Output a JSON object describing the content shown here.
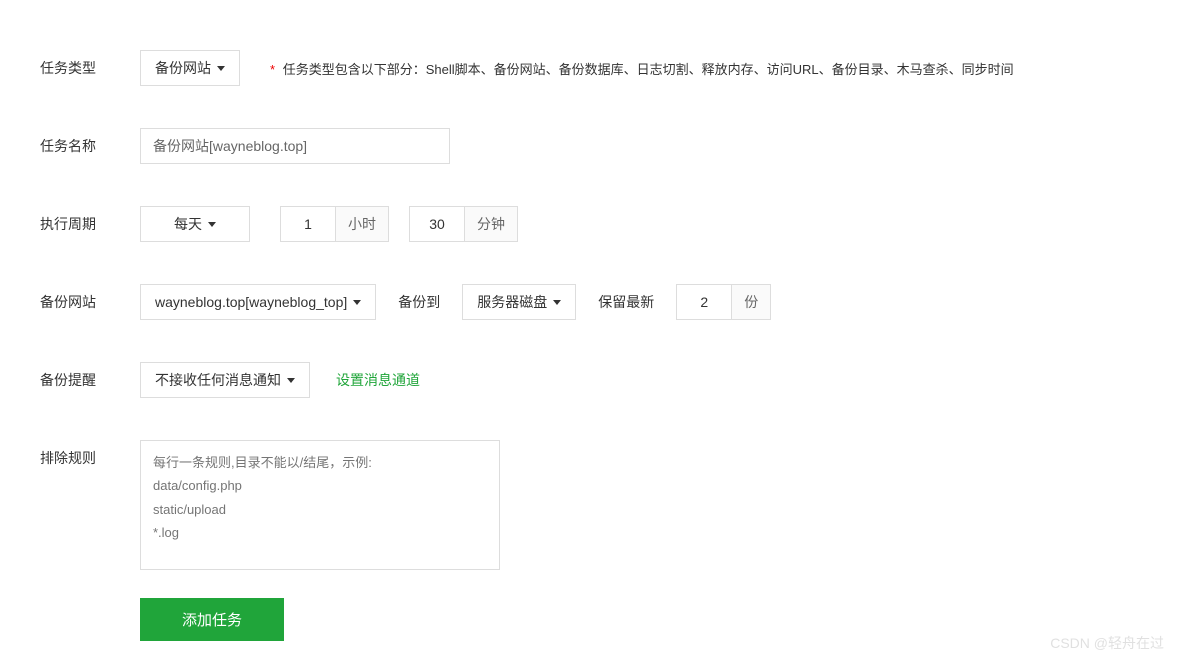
{
  "taskType": {
    "label": "任务类型",
    "value": "备份网站",
    "hint": "任务类型包含以下部分：Shell脚本、备份网站、备份数据库、日志切割、释放内存、访问URL、备份目录、木马查杀、同步时间"
  },
  "taskName": {
    "label": "任务名称",
    "value": "备份网站[wayneblog.top]"
  },
  "cycle": {
    "label": "执行周期",
    "frequency": "每天",
    "hour": "1",
    "hourUnit": "小时",
    "minute": "30",
    "minuteUnit": "分钟"
  },
  "backupSite": {
    "label": "备份网站",
    "site": "wayneblog.top[wayneblog_top]",
    "backupToLabel": "备份到",
    "backupTo": "服务器磁盘",
    "keepLabel": "保留最新",
    "keepCount": "2",
    "keepUnit": "份"
  },
  "notify": {
    "label": "备份提醒",
    "value": "不接收任何消息通知",
    "link": "设置消息通道"
  },
  "exclude": {
    "label": "排除规则",
    "placeholder": "每行一条规则,目录不能以/结尾，示例:\ndata/config.php\nstatic/upload\n*.log"
  },
  "submit": {
    "label": "添加任务"
  },
  "watermark": "CSDN @轻舟在过"
}
